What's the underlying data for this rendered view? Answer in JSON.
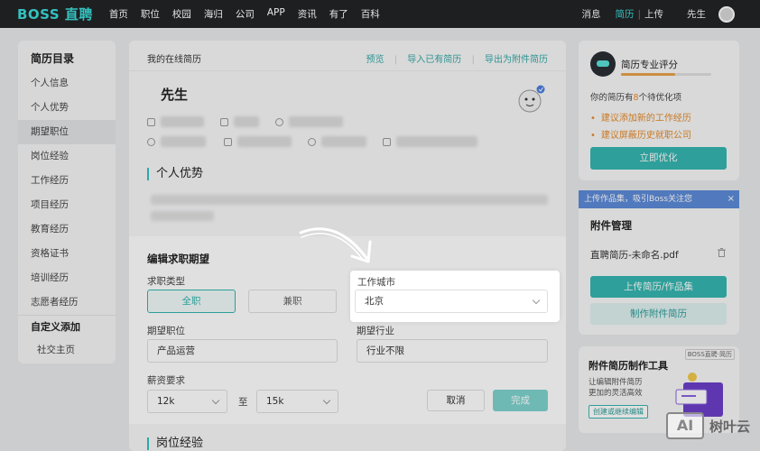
{
  "nav": {
    "logo": "BOSS 直聘",
    "links": [
      "首页",
      "职位",
      "校园",
      "海归",
      "公司",
      "APP",
      "资讯",
      "有了",
      "百科"
    ],
    "messages": "消息",
    "resume": "简历",
    "upload": "上传",
    "user": "先生"
  },
  "sidebar": {
    "title": "简历目录",
    "items": [
      "个人信息",
      "个人优势",
      "期望职位",
      "岗位经验",
      "工作经历",
      "项目经历",
      "教育经历",
      "资格证书",
      "培训经历",
      "志愿者经历"
    ],
    "custom_title": "自定义添加",
    "custom_items": [
      "社交主页"
    ]
  },
  "main": {
    "title": "我的在线简历",
    "actions": [
      "预览",
      "导入已有简历",
      "导出为附件简历"
    ],
    "name": "先生",
    "section_advantage": "个人优势",
    "section_job_exp": "岗位经验"
  },
  "edit": {
    "title": "编辑求职期望",
    "job_type_label": "求职类型",
    "job_types": [
      "全职",
      "兼职"
    ],
    "city_label": "工作城市",
    "city_value": "北京",
    "position_label": "期望职位",
    "position_value": "产品运营",
    "industry_label": "期望行业",
    "industry_value": "行业不限",
    "salary_label": "薪资要求",
    "salary_min": "12k",
    "salary_to": "至",
    "salary_max": "15k",
    "cancel": "取消",
    "done": "完成"
  },
  "score": {
    "title": "简历专业评分",
    "todo_prefix": "你的简历有",
    "todo_count": "8",
    "todo_suffix": "个待优化项",
    "tips": [
      "建议添加新的工作经历",
      "建议屏蔽历史就职公司"
    ],
    "button": "立即优化",
    "progress": 0.6
  },
  "banner": {
    "text": "上传作品集，吸引Boss关注您",
    "close": "×"
  },
  "attachments": {
    "title": "附件管理",
    "file": "直聘简历-未命名.pdf",
    "upload_button": "上传简历/作品集",
    "make_button": "制作附件简历"
  },
  "tool": {
    "tag": "BOSS直聘·简历",
    "title": "附件简历制作工具",
    "desc1": "让编辑附件简历",
    "desc2": "更加的灵活高效",
    "button": "创建或继续编辑"
  },
  "watermark": {
    "box": "AI",
    "text": "树叶云"
  },
  "colors": {
    "accent": "#35b5b0",
    "orange": "#e58a2a",
    "nav_bg": "#1e1f21"
  }
}
